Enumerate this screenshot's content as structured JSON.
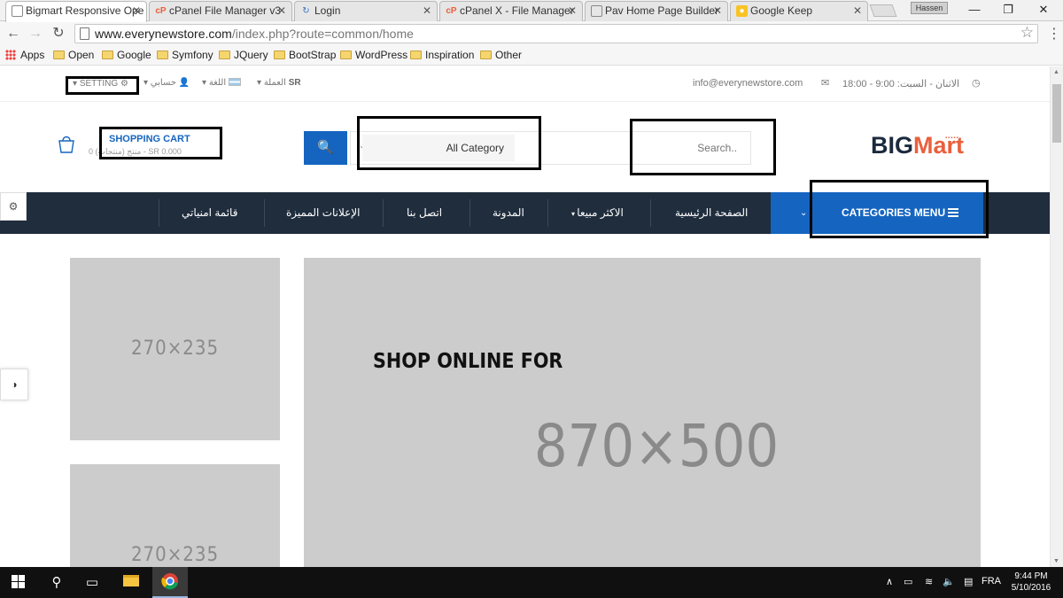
{
  "browser": {
    "tabs": [
      {
        "title": "Bigmart Responsive Ope",
        "active": true,
        "icon": "page-icon"
      },
      {
        "title": "cPanel File Manager v3",
        "active": false,
        "icon": "cpanel-icon"
      },
      {
        "title": "Login",
        "active": false,
        "icon": "login-icon"
      },
      {
        "title": "cPanel X - File Manager",
        "active": false,
        "icon": "cpanel-icon"
      },
      {
        "title": "Pav Home Page Builder",
        "active": false,
        "icon": "page-icon"
      },
      {
        "title": "Google Keep",
        "active": false,
        "icon": "keep-icon"
      }
    ],
    "profile_name": "Hassen",
    "url_host": "www.everynewstore.com",
    "url_path": "/index.php?route=common/home",
    "bookmarks": [
      "Apps",
      "Open",
      "Google",
      "Symfony",
      "JQuery",
      "BootStrap",
      "WordPress",
      "Inspiration",
      "Other"
    ]
  },
  "site": {
    "topbar": {
      "setting_label": "SETTING",
      "account_label": "حسابي",
      "language_label": "اللغة",
      "currency_label": "العملة",
      "currency_value": "SR",
      "email": "info@everynewstore.com",
      "hours": "الاثنان - السبت: 9:00 - 18:00"
    },
    "header": {
      "cart_title": "SHOPPING CART",
      "cart_summary": "0 منتج (منتجات) - SR 0.000",
      "category_select": "All Category",
      "search_placeholder": "Search..",
      "logo_big": "BIG",
      "logo_mart": "Mart"
    },
    "nav": {
      "categories_menu": "CATEGORIES MENU",
      "items": [
        "الصفحة الرئيسية",
        "الاكثر مبيعا",
        "المدونة",
        "اتصل بنا",
        "الإعلانات المميزة",
        "قائمة امنياتي"
      ]
    },
    "content": {
      "side_banner_1": "270×235",
      "side_banner_2": "270×235",
      "slide_title": "SHOP ONLINE FOR",
      "slide_size": "870×500"
    }
  },
  "taskbar": {
    "language": "FRA",
    "time": "9:44 PM",
    "date": "5/10/2016"
  },
  "colors": {
    "brand_blue": "#1565c0",
    "nav_dark": "#1f2d3d",
    "logo_orange": "#e8603c",
    "placeholder_gray": "#cccccc"
  }
}
